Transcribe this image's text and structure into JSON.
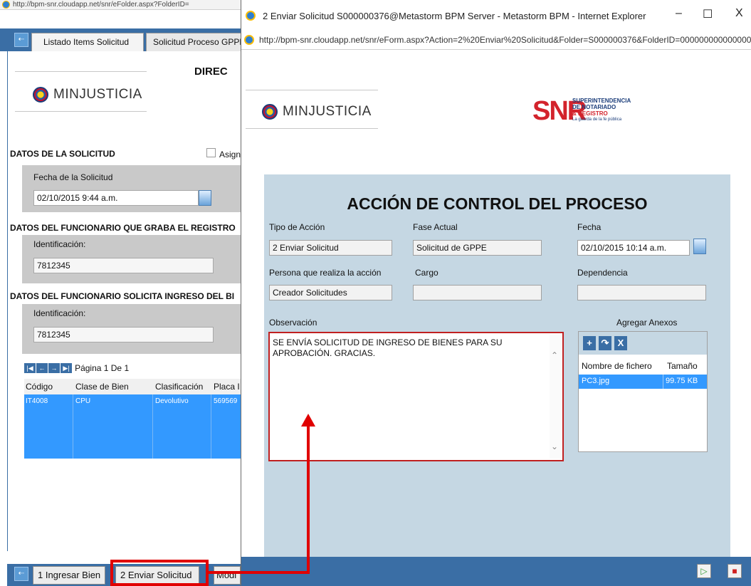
{
  "background_window": {
    "address": "http://bpm-snr.cloudapp.net/snr/eFolder.aspx?FolderID=",
    "tabs": [
      "Listado Items Solicitud",
      "Solicitud Proceso GPPE"
    ],
    "header_title": "DIREC",
    "logo_text": "MINJUSTICIA",
    "section_solicitud": "DATOS DE LA SOLICITUD",
    "assign_label": "Asign",
    "fecha_label": "Fecha de la Solicitud",
    "fecha_value": "02/10/2015 9:44 a.m.",
    "section_funcionario_graba": "DATOS DEL FUNCIONARIO QUE GRABA EL REGISTRO",
    "id_label_1": "Identificación:",
    "id_value_1": "7812345",
    "section_funcionario_ingreso": "DATOS DEL FUNCIONARIO SOLICITA INGRESO DEL BI",
    "id_label_2": "Identificación:",
    "id_value_2": "7812345",
    "pager_text": "Página 1 De 1",
    "grid_headers": [
      "Código",
      "Clase de Bien",
      "Clasificación",
      "Placa I"
    ],
    "grid_row": [
      "IT4008",
      "CPU",
      "Devolutivo",
      "569569"
    ],
    "bottom_buttons": [
      "1 Ingresar Bien",
      "2 Enviar Solicitud",
      "Modi"
    ]
  },
  "popup": {
    "window_title": "2 Enviar Solicitud S000000376@Metastorm BPM Server - Metastorm BPM - Internet Explorer",
    "window_controls": [
      "–",
      "☐",
      "X"
    ],
    "url": "http://bpm-snr.cloudapp.net/snr/eForm.aspx?Action=2%20Enviar%20Solicitud&Folder=S000000376&FolderID=000000000000000",
    "logo_text": "MINJUSTICIA",
    "snr_letters": "SNR",
    "snr_sub": [
      "SUPERINTENDENCIA",
      "DE NOTARIADO",
      "& REGISTRO",
      "La guarda de la fe pública"
    ],
    "form_title": "ACCIÓN DE CONTROL DEL PROCESO",
    "fields": {
      "tipo_label": "Tipo de Acción",
      "tipo_value": "2 Enviar Solicitud",
      "fase_label": "Fase Actual",
      "fase_value": "Solicitud de GPPE",
      "fecha_label": "Fecha",
      "fecha_value": "02/10/2015 10:14 a.m.",
      "persona_label": "Persona que realiza la acción",
      "persona_value": "Creador Solicitudes",
      "cargo_label": "Cargo",
      "cargo_value": "",
      "dependencia_label": "Dependencia",
      "dependencia_value": ""
    },
    "observacion_label": "Observación",
    "observacion_text": "SE ENVÍA SOLICITUD DE INGRESO DE BIENES PARA SU APROBACIÓN. GRACIAS.",
    "anexos_label": "Agregar Anexos",
    "anexos_headers": [
      "Nombre de fichero",
      "Tamaño"
    ],
    "anexos_row": [
      "PC3.jpg",
      "99.75 KB"
    ],
    "tool_icons": [
      "+",
      "↷",
      "X"
    ],
    "footer_icons": [
      "▷",
      "■"
    ]
  },
  "colors": {
    "accent_blue": "#3a6ea5",
    "selection_blue": "#3399ff",
    "form_bg": "#c5d7e3",
    "annotation_red": "#e00000"
  }
}
